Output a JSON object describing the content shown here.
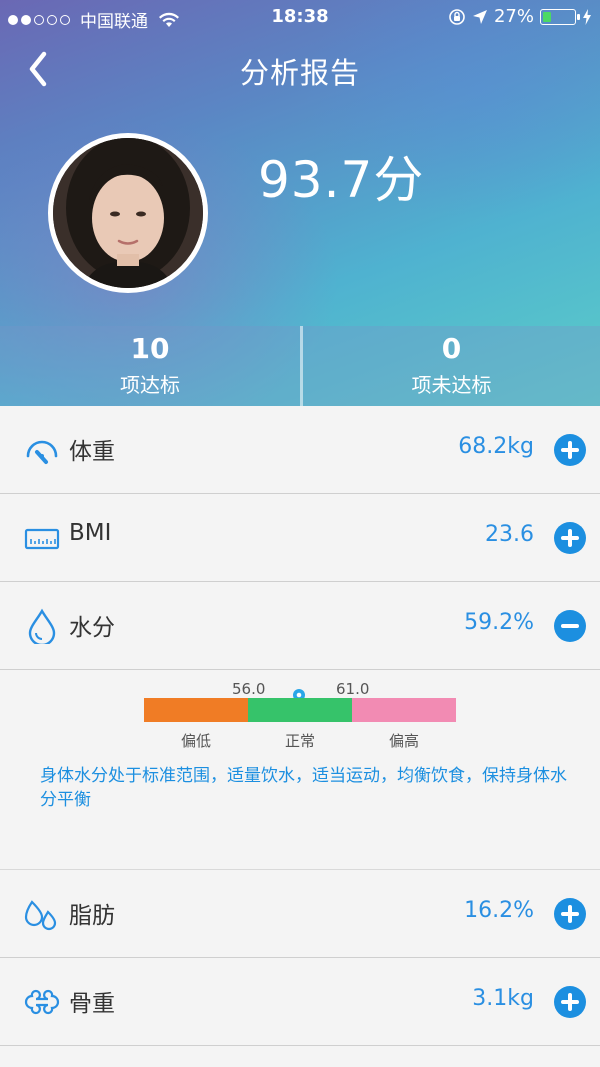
{
  "status_bar": {
    "carrier": "中国联通",
    "time": "18:38",
    "battery_percent": "27%",
    "signal_bars_filled": 2,
    "signal_bars_total": 5,
    "battery_level": 0.27
  },
  "nav": {
    "title": "分析报告",
    "back_icon": "chevron-left-icon"
  },
  "profile": {
    "score": "93.7分"
  },
  "stats": [
    {
      "count": "10",
      "label": "项达标"
    },
    {
      "count": "0",
      "label": "项未达标"
    }
  ],
  "metrics": [
    {
      "icon": "gauge-icon",
      "name": "体重",
      "value": "68.2kg",
      "toggle": "plus"
    },
    {
      "icon": "ruler-icon",
      "name": "BMI",
      "value": "23.6",
      "toggle": "plus"
    },
    {
      "icon": "water-drop-icon",
      "name": "水分",
      "value": "59.2%",
      "toggle": "minus"
    },
    {
      "icon": "fat-drops-icon",
      "name": "脂肪",
      "value": "16.2%",
      "toggle": "plus"
    },
    {
      "icon": "bone-icon",
      "name": "骨重",
      "value": "3.1kg",
      "toggle": "plus"
    }
  ],
  "water_detail": {
    "low_threshold": "56.0",
    "high_threshold": "61.0",
    "range_labels": [
      "偏低",
      "正常",
      "偏高"
    ],
    "advice": "身体水分处于标准范围，适量饮水，适当运动，均衡饮食，保持身体水分平衡",
    "colors": {
      "low": "#f07c25",
      "normal": "#36c36a",
      "high": "#f28bb3"
    }
  },
  "colors": {
    "accent": "#1c8fe0",
    "value_text": "#2a8fe2"
  }
}
